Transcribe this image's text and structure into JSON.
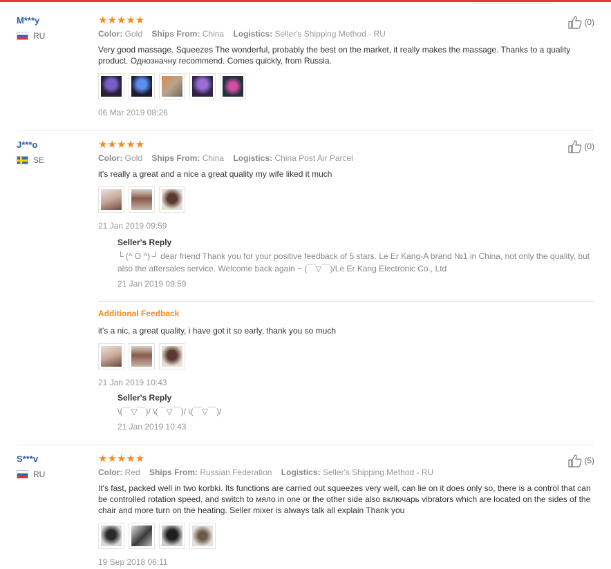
{
  "reviews": [
    {
      "user": "M***y",
      "country": "RU",
      "stars": "★★★★★",
      "color_label": "Color:",
      "color": "Gold",
      "ships_label": "Ships From:",
      "ships": "China",
      "logistics_label": "Logistics:",
      "logistics": "Seller's Shipping Method - RU",
      "text": "Very good massage. Squeezes The wonderful, probably the best on the market, it really makes the massage. Thanks to a quality product. Однозначну recommend. Comes quickly, from Russia.",
      "date": "06 Mar 2019 08:26",
      "likes": "(0)"
    },
    {
      "user": "J***o",
      "country": "SE",
      "stars": "★★★★★",
      "color_label": "Color:",
      "color": "Gold",
      "ships_label": "Ships From:",
      "ships": "China",
      "logistics_label": "Logistics:",
      "logistics": "China Post Air Parcel",
      "text": "it's really a great and a nice a great quality my wife liked it much",
      "date": "21 Jan 2019 09:59",
      "likes": "(0)",
      "reply_title": "Seller's Reply",
      "reply_text": "└ (^ O ^) ┘ dear friend Thank you for your positive feedback of 5 stars. Le Er Kang-A brand №1 in China, not only the quality, but also the aftersales service. Welcome back again ~ (￣▽￣)/Le Er Kang Electronic Co., Ltd",
      "reply_date": "21 Jan 2019 09:59",
      "additional_label": "Additional Feedback",
      "additional_text": "it's a nic, a great quality, i have got it so early, thank you so much",
      "additional_date": "21 Jan 2019 10:43",
      "reply2_title": "Seller's Reply",
      "reply2_text": "\\(￣▽￣)/ \\(￣▽￣)/ \\(￣▽￣)/",
      "reply2_date": "21 Jan 2019 10:43"
    },
    {
      "user": "S***v",
      "country": "RU",
      "stars": "★★★★★",
      "color_label": "Color:",
      "color": "Red",
      "ships_label": "Ships From:",
      "ships": "Russian Federation",
      "logistics_label": "Logistics:",
      "logistics": "Seller's Shipping Method - RU",
      "text": "It's fast, packed well in two korbki. Its functions are carried out squeezes very well, can lie on it does only so, there is a control that can be controlled rotation speed, and switch to мяло in one or the other side also включарь vibrators which are located on the sides of the chair and more turn on the heating. Seller mixer is always talk all explain Thank you",
      "date": "19 Sep 2018 06:11",
      "likes": "(5)"
    }
  ],
  "colors": {
    "star": "#f58a1f",
    "username": "#2a5ca8",
    "additional": "#f58a1f"
  },
  "icons": {
    "like": "thumbs-up-icon"
  }
}
